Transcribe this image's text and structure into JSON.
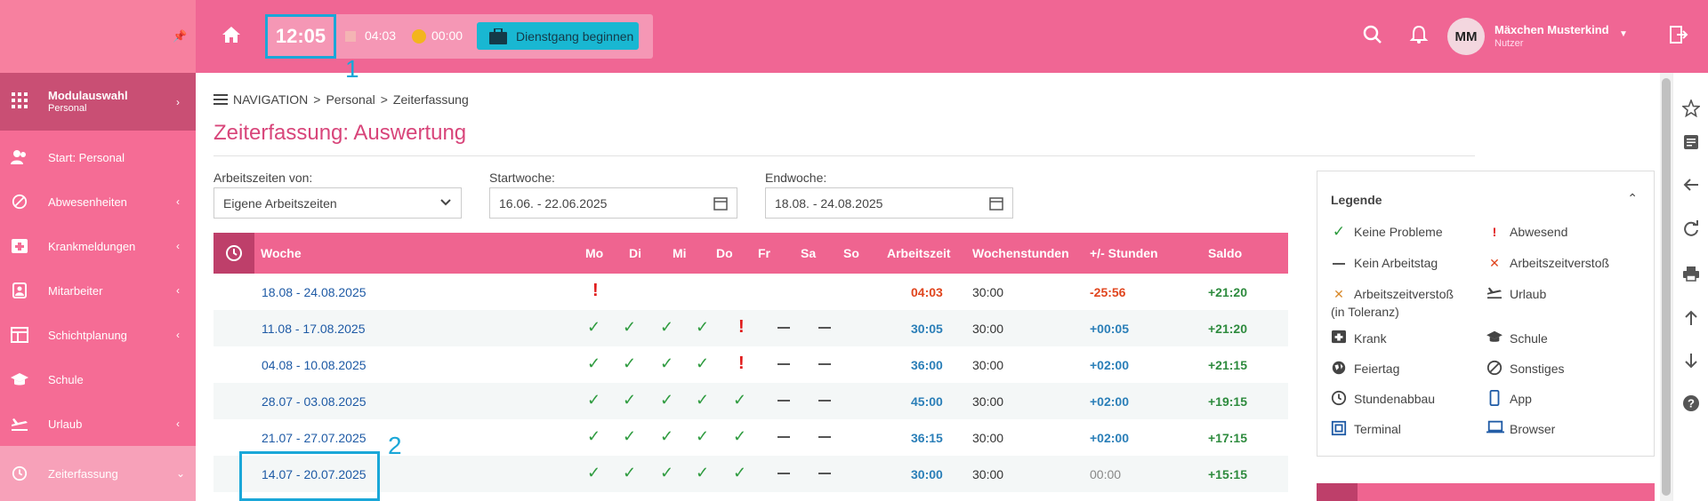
{
  "header": {
    "clock": "12:05",
    "timer_work": "04:03",
    "timer_pause": "00:00",
    "dienstgang_label": "Dienstgang beginnen",
    "annotation_1": "1",
    "user_initials": "MM",
    "user_name": "Mäxchen Musterkind",
    "user_role": "Nutzer"
  },
  "sidebar": {
    "modul_title": "Modulauswahl",
    "modul_sub": "Personal",
    "items": [
      {
        "label": "Start: Personal"
      },
      {
        "label": "Abwesenheiten"
      },
      {
        "label": "Krankmeldungen"
      },
      {
        "label": "Mitarbeiter"
      },
      {
        "label": "Schichtplanung"
      },
      {
        "label": "Schule"
      },
      {
        "label": "Urlaub"
      },
      {
        "label": "Zeiterfassung"
      }
    ]
  },
  "breadcrumb": [
    "NAVIGATION",
    "Personal",
    "Zeiterfassung"
  ],
  "page_title": "Zeiterfassung: Auswertung",
  "filters": {
    "arbeitszeiten_label": "Arbeitszeiten von:",
    "arbeitszeiten_value": "Eigene Arbeitszeiten",
    "startwoche_label": "Startwoche:",
    "startwoche_value": "16.06. - 22.06.2025",
    "endwoche_label": "Endwoche:",
    "endwoche_value": "18.08. - 24.08.2025"
  },
  "table": {
    "headers": [
      "Woche",
      "Mo",
      "Di",
      "Mi",
      "Do",
      "Fr",
      "Sa",
      "So",
      "Arbeitszeit",
      "Wochenstunden",
      "+/- Stunden",
      "Saldo"
    ],
    "rows": [
      {
        "woche": "18.08 - 24.08.2025",
        "days": [
          "excl",
          "",
          "",
          "",
          "",
          "",
          ""
        ],
        "arbeitszeit": "04:03",
        "az_color": "red",
        "wochenstunden": "30:00",
        "plusminus": "-25:56",
        "pm_color": "red",
        "saldo": "+21:20"
      },
      {
        "woche": "11.08 - 17.08.2025",
        "days": [
          "check",
          "check",
          "check",
          "check",
          "excl",
          "dash",
          "dash"
        ],
        "arbeitszeit": "30:05",
        "az_color": "blue",
        "wochenstunden": "30:00",
        "plusminus": "+00:05",
        "pm_color": "blue",
        "saldo": "+21:20"
      },
      {
        "woche": "04.08 - 10.08.2025",
        "days": [
          "check",
          "check",
          "check",
          "check",
          "excl",
          "dash",
          "dash"
        ],
        "arbeitszeit": "36:00",
        "az_color": "blue",
        "wochenstunden": "30:00",
        "plusminus": "+02:00",
        "pm_color": "blue",
        "saldo": "+21:15"
      },
      {
        "woche": "28.07 - 03.08.2025",
        "days": [
          "check",
          "check",
          "check",
          "check",
          "check",
          "dash",
          "dash"
        ],
        "arbeitszeit": "45:00",
        "az_color": "blue",
        "wochenstunden": "30:00",
        "plusminus": "+02:00",
        "pm_color": "blue",
        "saldo": "+19:15"
      },
      {
        "woche": "21.07 - 27.07.2025",
        "days": [
          "check",
          "check",
          "check",
          "check",
          "check",
          "dash",
          "dash"
        ],
        "arbeitszeit": "36:15",
        "az_color": "blue",
        "wochenstunden": "30:00",
        "plusminus": "+02:00",
        "pm_color": "blue",
        "saldo": "+17:15"
      },
      {
        "woche": "14.07 - 20.07.2025",
        "days": [
          "check",
          "check",
          "check",
          "check",
          "check",
          "dash",
          "dash"
        ],
        "arbeitszeit": "30:00",
        "az_color": "blue",
        "wochenstunden": "30:00",
        "plusminus": "00:00",
        "pm_color": "gray",
        "saldo": "+15:15"
      }
    ],
    "annotation_2": "2"
  },
  "legend": {
    "title": "Legende",
    "items": [
      {
        "icon": "check-icon",
        "label": "Keine Probleme"
      },
      {
        "icon": "exclamation-icon",
        "label": "Abwesend"
      },
      {
        "icon": "dash-icon",
        "label": "Kein Arbeitstag"
      },
      {
        "icon": "cross-red-icon",
        "label": "Arbeitszeitverstoß"
      },
      {
        "icon": "cross-orange-icon",
        "label": "Arbeitszeitverstoß",
        "label2": "(in Toleranz)"
      },
      {
        "icon": "plane-icon",
        "label": "Urlaub"
      },
      {
        "icon": "medical-icon",
        "label": "Krank"
      },
      {
        "icon": "graduation-icon",
        "label": "Schule"
      },
      {
        "icon": "globe-icon",
        "label": "Feiertag"
      },
      {
        "icon": "ban-icon",
        "label": "Sonstiges"
      },
      {
        "icon": "clock-icon",
        "label": "Stundenabbau"
      },
      {
        "icon": "phone-icon",
        "label": "App"
      },
      {
        "icon": "terminal-icon",
        "label": "Terminal"
      },
      {
        "icon": "laptop-icon",
        "label": "Browser"
      }
    ]
  }
}
